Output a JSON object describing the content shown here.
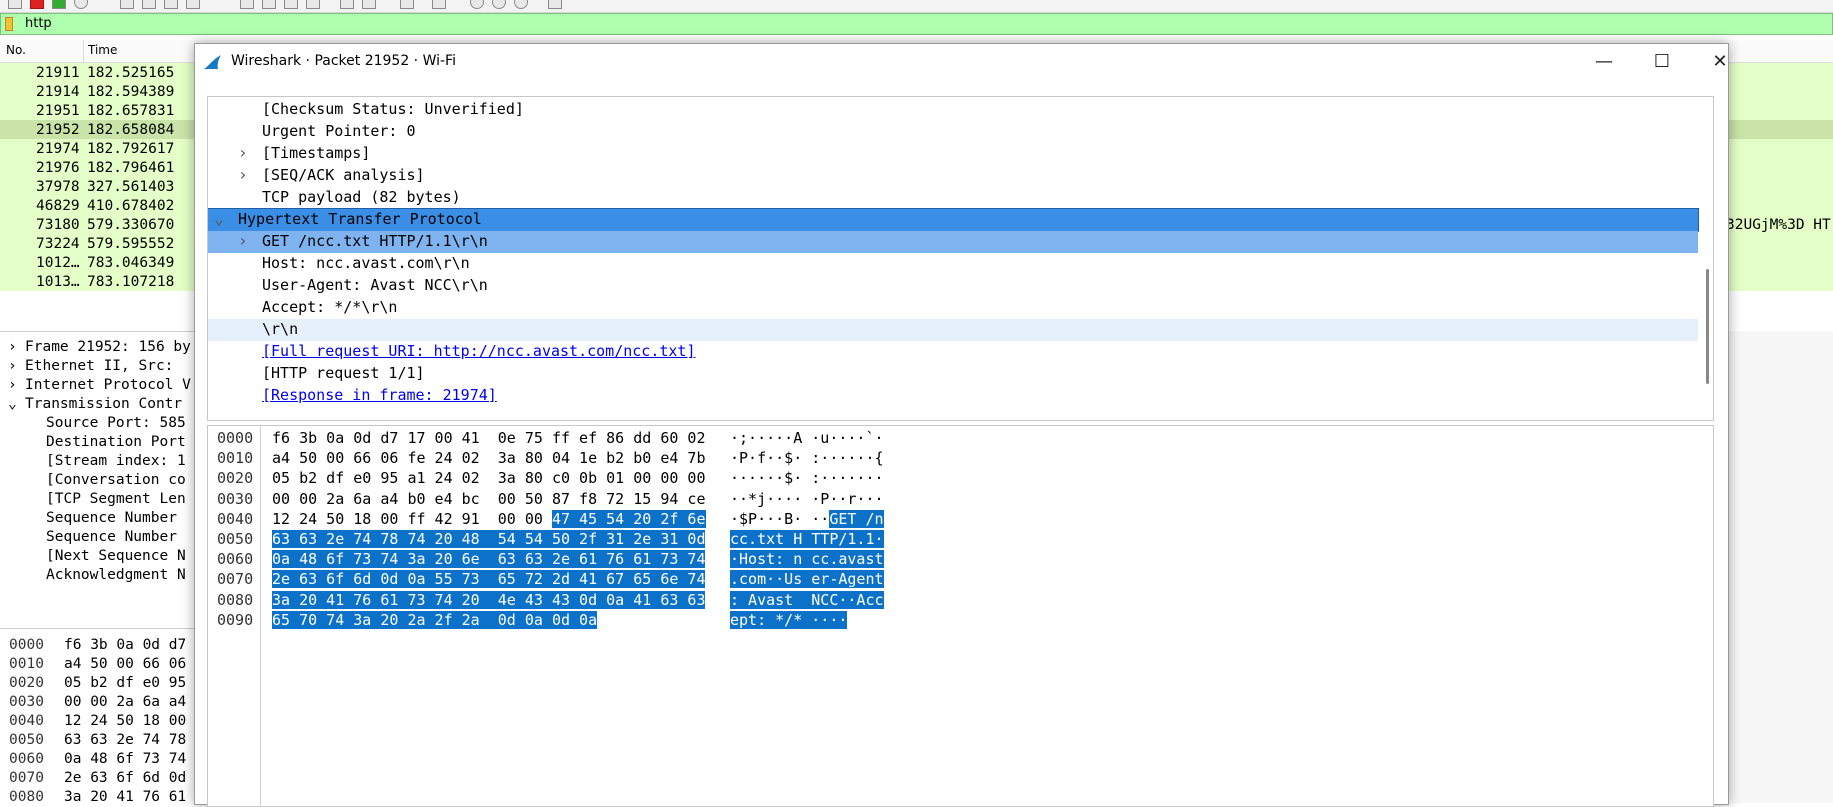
{
  "main": {
    "display_filter": "http",
    "columns": [
      "No.",
      "Time"
    ],
    "packets": [
      {
        "no": "21911",
        "time": "182.525165",
        "tail": ""
      },
      {
        "no": "21914",
        "time": "182.594389",
        "tail": ""
      },
      {
        "no": "21951",
        "time": "182.657831",
        "tail": ""
      },
      {
        "no": "21952",
        "time": "182.658084",
        "tail": ""
      },
      {
        "no": "21974",
        "time": "182.792617",
        "tail": ""
      },
      {
        "no": "21976",
        "time": "182.796461",
        "tail": ""
      },
      {
        "no": "37978",
        "time": "327.561403",
        "tail": ""
      },
      {
        "no": "46829",
        "time": "410.678402",
        "tail": ""
      },
      {
        "no": "73180",
        "time": "579.330670",
        "tail": "32UGjM%3D HT"
      },
      {
        "no": "73224",
        "time": "579.595552",
        "tail": ""
      },
      {
        "no": "1012…",
        "time": "783.046349",
        "tail": ""
      },
      {
        "no": "1013…",
        "time": "783.107218",
        "tail": ""
      }
    ],
    "selected_packet": "21952",
    "tree": [
      {
        "arrow": "›",
        "text": "Frame 21952: 156 by"
      },
      {
        "arrow": "›",
        "text": "Ethernet II, Src: "
      },
      {
        "arrow": "›",
        "text": "Internet Protocol V"
      },
      {
        "arrow": "⌄",
        "text": "Transmission Contr"
      },
      {
        "arrow": "",
        "text": "Source Port: 585"
      },
      {
        "arrow": "",
        "text": "Destination Port"
      },
      {
        "arrow": "",
        "text": "[Stream index: 1"
      },
      {
        "arrow": "",
        "text": "[Conversation co"
      },
      {
        "arrow": "",
        "text": "[TCP Segment Len"
      },
      {
        "arrow": "",
        "text": "Sequence Number"
      },
      {
        "arrow": "",
        "text": "Sequence Number"
      },
      {
        "arrow": "",
        "text": "[Next Sequence N"
      },
      {
        "arrow": "",
        "text": "Acknowledgment N"
      }
    ],
    "bytes": [
      {
        "off": "0000",
        "hex": "f6 3b 0a 0d d7"
      },
      {
        "off": "0010",
        "hex": "a4 50 00 66 06"
      },
      {
        "off": "0020",
        "hex": "05 b2 df e0 95"
      },
      {
        "off": "0030",
        "hex": "00 00 2a 6a a4"
      },
      {
        "off": "0040",
        "hex": "12 24 50 18 00"
      },
      {
        "off": "0050",
        "hex": "63 63 2e 74 78"
      },
      {
        "off": "0060",
        "hex": "0a 48 6f 73 74"
      },
      {
        "off": "0070",
        "hex": "2e 63 6f 6d 0d"
      },
      {
        "off": "0080",
        "hex": "3a 20 41 76 61"
      }
    ]
  },
  "dialog": {
    "title": "Wireshark · Packet 21952 · Wi-Fi",
    "controls": {
      "minimize": "—",
      "maximize": "☐",
      "close": "✕"
    },
    "detail": [
      {
        "arrow": "",
        "text": "[Checksum Status: Unverified]",
        "style": ""
      },
      {
        "arrow": "",
        "text": "Urgent Pointer: 0",
        "style": ""
      },
      {
        "arrow": "›",
        "text": "[Timestamps]",
        "style": ""
      },
      {
        "arrow": "›",
        "text": "[SEQ/ACK analysis]",
        "style": ""
      },
      {
        "arrow": "",
        "text": "TCP payload (82 bytes)",
        "style": ""
      },
      {
        "arrow": "⌄",
        "text": "Hypertext Transfer Protocol",
        "style": "main"
      },
      {
        "arrow": "›",
        "text": "GET /ncc.txt HTTP/1.1\\r\\n",
        "style": "sub"
      },
      {
        "arrow": "",
        "text": "Host: ncc.avast.com\\r\\n",
        "style": ""
      },
      {
        "arrow": "",
        "text": "User-Agent: Avast NCC\\r\\n",
        "style": ""
      },
      {
        "arrow": "",
        "text": "Accept: */*\\r\\n",
        "style": ""
      },
      {
        "arrow": "",
        "text": "\\r\\n",
        "style": "light"
      },
      {
        "arrow": "",
        "text": "[Full request URI: http://ncc.avast.com/ncc.txt]",
        "style": "link"
      },
      {
        "arrow": "",
        "text": "[HTTP request 1/1]",
        "style": ""
      },
      {
        "arrow": "",
        "text": "[Response in frame: 21974]",
        "style": "link"
      }
    ],
    "bytes": [
      {
        "off": "0000",
        "hex": [
          "f6 3b 0a 0d d7 17 00 41  0e 75 ff ef 86 dd 60 02",
          ""
        ],
        "ascii": [
          "·;·····A ·u····`·",
          ""
        ]
      },
      {
        "off": "0010",
        "hex": [
          "a4 50 00 66 06 fe 24 02  3a 80 04 1e b2 b0 e4 7b",
          ""
        ],
        "ascii": [
          "·P·f··$· :······{",
          ""
        ]
      },
      {
        "off": "0020",
        "hex": [
          "05 b2 df e0 95 a1 24 02  3a 80 c0 0b 01 00 00 00",
          ""
        ],
        "ascii": [
          "······$· :·······",
          ""
        ]
      },
      {
        "off": "0030",
        "hex": [
          "00 00 2a 6a a4 b0 e4 bc  00 50 87 f8 72 15 94 ce",
          ""
        ],
        "ascii": [
          "··*j···· ·P··r···",
          ""
        ]
      },
      {
        "off": "0040",
        "hex": [
          "12 24 50 18 00 ff 42 91  00 00 ",
          "47 45 54 20 2f 6e"
        ],
        "ascii": [
          "·$P···B· ··",
          "GET /n"
        ]
      },
      {
        "off": "0050",
        "hex": [
          "",
          "63 63 2e 74 78 74 20 48  54 54 50 2f 31 2e 31 0d"
        ],
        "ascii": [
          "",
          "cc.txt H TTP/1.1·"
        ]
      },
      {
        "off": "0060",
        "hex": [
          "",
          "0a 48 6f 73 74 3a 20 6e  63 63 2e 61 76 61 73 74"
        ],
        "ascii": [
          "",
          "·Host: n cc.avast"
        ]
      },
      {
        "off": "0070",
        "hex": [
          "",
          "2e 63 6f 6d 0d 0a 55 73  65 72 2d 41 67 65 6e 74"
        ],
        "ascii": [
          "",
          ".com··Us er-Agent"
        ]
      },
      {
        "off": "0080",
        "hex": [
          "",
          "3a 20 41 76 61 73 74 20  4e 43 43 0d 0a 41 63 63"
        ],
        "ascii": [
          "",
          ": Avast  NCC··Acc"
        ]
      },
      {
        "off": "0090",
        "hex": [
          "",
          "65 70 74 3a 20 2a 2f 2a  0d 0a 0d 0a"
        ],
        "ascii": [
          "",
          "ept: */* ····"
        ]
      }
    ]
  }
}
